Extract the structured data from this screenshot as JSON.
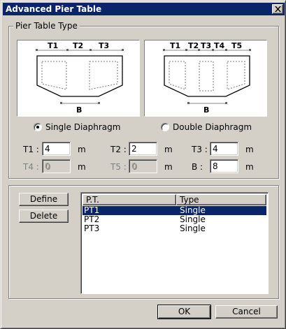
{
  "window": {
    "title": "Advanced Pier Table"
  },
  "pier_table_type": {
    "legend": "Pier Table Type",
    "single_diagram": {
      "labels": [
        "T1",
        "T2",
        "T3"
      ],
      "bottom_label": "B"
    },
    "double_diagram": {
      "labels": [
        "T1",
        "T2",
        "T3",
        "T4",
        "T5"
      ],
      "bottom_label": "B"
    },
    "single_radio_label": "Single Diaphragm",
    "double_radio_label": "Double Diaphragm",
    "selected_type": "Single Diaphragm"
  },
  "params": {
    "t1": {
      "label": "T1 :",
      "value": "4",
      "unit": "m",
      "enabled": true
    },
    "t2": {
      "label": "T2 :",
      "value": "2",
      "unit": "m",
      "enabled": true
    },
    "t3": {
      "label": "T3 :",
      "value": "4",
      "unit": "m",
      "enabled": true
    },
    "t4": {
      "label": "T4 :",
      "value": "0",
      "unit": "m",
      "enabled": false
    },
    "t5": {
      "label": "T5 :",
      "value": "0",
      "unit": "m",
      "enabled": false
    },
    "b": {
      "label": "B  :",
      "value": "8",
      "unit": "m",
      "enabled": true
    }
  },
  "buttons": {
    "define": "Define",
    "delete": "Delete",
    "ok": "OK",
    "cancel": "Cancel"
  },
  "table": {
    "headers": [
      "P.T.",
      "Type"
    ],
    "rows": [
      {
        "pt": "PT1",
        "type": "Single",
        "selected": true
      },
      {
        "pt": "PT2",
        "type": "Single",
        "selected": false
      },
      {
        "pt": "PT3",
        "type": "Single",
        "selected": false
      }
    ]
  },
  "colors": {
    "face": "#d4d0c8",
    "title": "#0a246a",
    "selection": "#0a246a"
  }
}
